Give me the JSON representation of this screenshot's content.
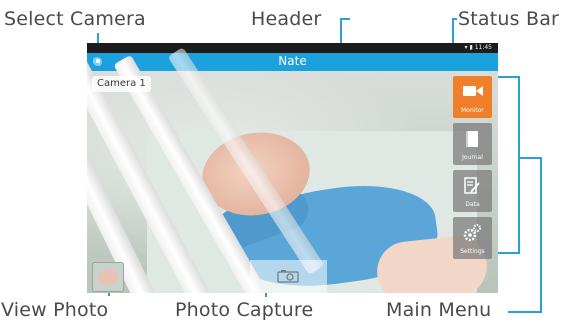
{
  "callouts": {
    "select_camera": "Select Camera",
    "header": "Header",
    "status_bar": "Status Bar",
    "view_photo": "View Photo",
    "photo_capture": "Photo Capture",
    "main_menu": "Main Menu"
  },
  "status_bar": {
    "time": "11:45",
    "icons": "wifi-icon, battery-icon"
  },
  "header": {
    "title": "Nate"
  },
  "camera_select": {
    "label": "Camera 1"
  },
  "main_menu": {
    "items": [
      {
        "label": "Monitor",
        "icon": "video-camera-icon",
        "active": true
      },
      {
        "label": "Journal",
        "icon": "book-icon",
        "active": false
      },
      {
        "label": "Data",
        "icon": "edit-document-icon",
        "active": false
      },
      {
        "label": "Settings",
        "icon": "gears-icon",
        "active": false
      }
    ]
  },
  "colors": {
    "accent": "#1ba1de",
    "callout_line": "#2a9fd8",
    "active_menu": "#f07f2c"
  }
}
